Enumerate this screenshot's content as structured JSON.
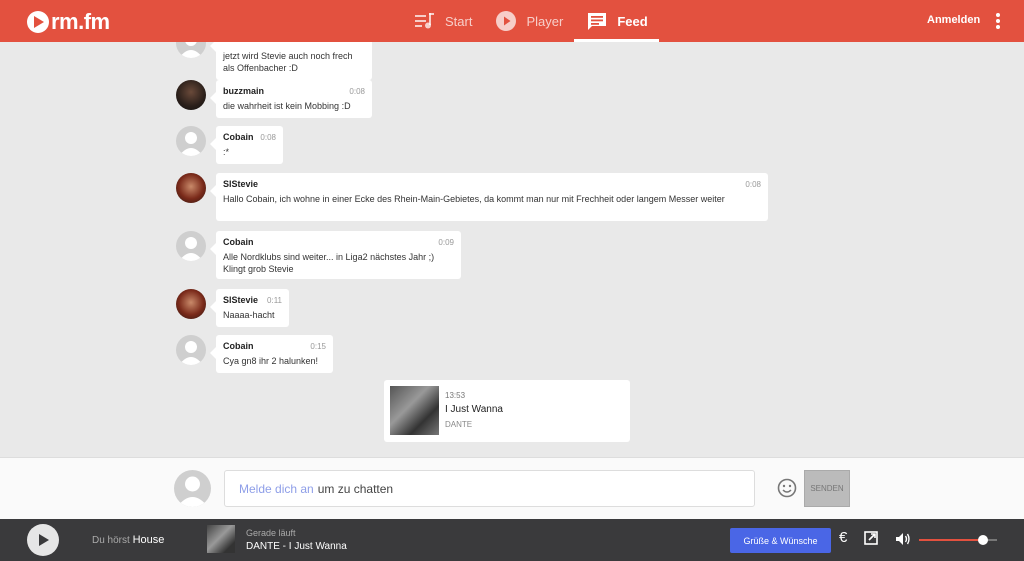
{
  "header": {
    "logo_text": "rm.fm",
    "nav": [
      {
        "label": "Start",
        "icon": "music-queue-icon",
        "active": false
      },
      {
        "label": "Player",
        "icon": "play-circle-icon",
        "active": false
      },
      {
        "label": "Feed",
        "icon": "chat-icon",
        "active": true
      }
    ],
    "login_label": "Anmelden",
    "accent_color": "#e3513f"
  },
  "feed": {
    "messages": [
      {
        "user": "",
        "time": "",
        "text": "jetzt wird Stevie auch noch frech als Offenbacher :D",
        "avatar": "default"
      },
      {
        "user": "buzzmain",
        "time": "0:08",
        "text": "die wahrheit ist kein Mobbing :D",
        "avatar": "photo-dark"
      },
      {
        "user": "Cobain",
        "time": "0:08",
        "text": ":*",
        "avatar": "default"
      },
      {
        "user": "SlStevie",
        "time": "0:08",
        "text": "Hallo Cobain, ich wohne in einer Ecke des Rhein-Main-Gebietes, da kommt man nur mit Frechheit oder langem Messer weiter",
        "avatar": "photo-red"
      },
      {
        "user": "Cobain",
        "time": "0:09",
        "text": "Alle Nordklubs sind weiter... in Liga2 nächstes Jahr ;) Klingt grob Stevie",
        "avatar": "default"
      },
      {
        "user": "SlStevie",
        "time": "0:11",
        "text": "Naaaa-hacht",
        "avatar": "photo-red"
      },
      {
        "user": "Cobain",
        "time": "0:15",
        "text": "Cya gn8 ihr 2 halunken!",
        "avatar": "default"
      }
    ],
    "track_card": {
      "time": "13:53",
      "title": "I Just Wanna",
      "artist": "DANTE"
    }
  },
  "chat": {
    "login_link": "Melde dich an",
    "prompt_rest": "um zu chatten",
    "send_label": "SENDEN"
  },
  "player": {
    "listening_prefix": "Du hörst",
    "channel": "House",
    "now_playing_label": "Gerade läuft",
    "now_playing_track": "DANTE - I Just Wanna",
    "wishes_label": "Grüße & Wünsche",
    "euro_symbol": "€",
    "volume_level": 0.82,
    "wishes_color": "#4a66e6"
  }
}
